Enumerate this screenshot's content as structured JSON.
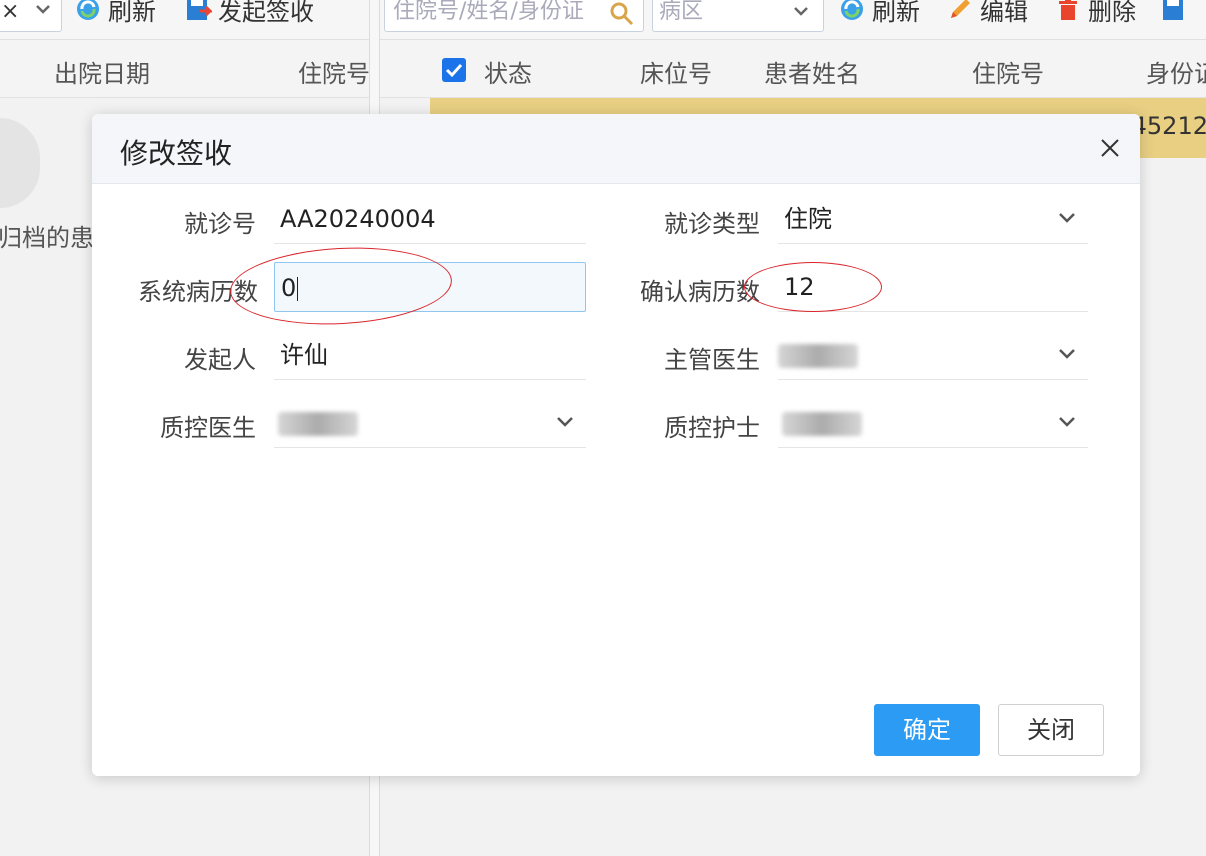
{
  "left_pane": {
    "toolbar": {
      "select_value": "×",
      "refresh_label": "刷新",
      "initiate_label": "发起签收"
    },
    "columns": [
      "出院日期",
      "住院号"
    ],
    "empty_text": "归档的患者"
  },
  "right_pane": {
    "toolbar": {
      "search_placeholder": "住院号/姓名/身份证",
      "ward_placeholder": "病区",
      "refresh_label": "刷新",
      "edit_label": "编辑",
      "delete_label": "删除"
    },
    "columns": [
      "状态",
      "床位号",
      "患者姓名",
      "住院号",
      "身份证"
    ],
    "selected_row_cell": "45212"
  },
  "modal": {
    "title": "修改签收",
    "fields": {
      "visit_no": {
        "label": "就诊号",
        "value": "AA20240004"
      },
      "visit_type": {
        "label": "就诊类型",
        "value": "住院"
      },
      "system_records": {
        "label": "系统病历数",
        "value": "0"
      },
      "confirmed_records": {
        "label": "确认病历数",
        "value": "12"
      },
      "initiator": {
        "label": "发起人",
        "value": "许仙"
      },
      "attending_doctor": {
        "label": "主管医生"
      },
      "qc_doctor": {
        "label": "质控医生"
      },
      "qc_nurse": {
        "label": "质控护士"
      }
    },
    "ok_label": "确定",
    "close_label": "关闭"
  },
  "colors": {
    "primary": "#2b9bf4",
    "selected_row": "#e8cf82",
    "annotation": "#d9262c"
  }
}
